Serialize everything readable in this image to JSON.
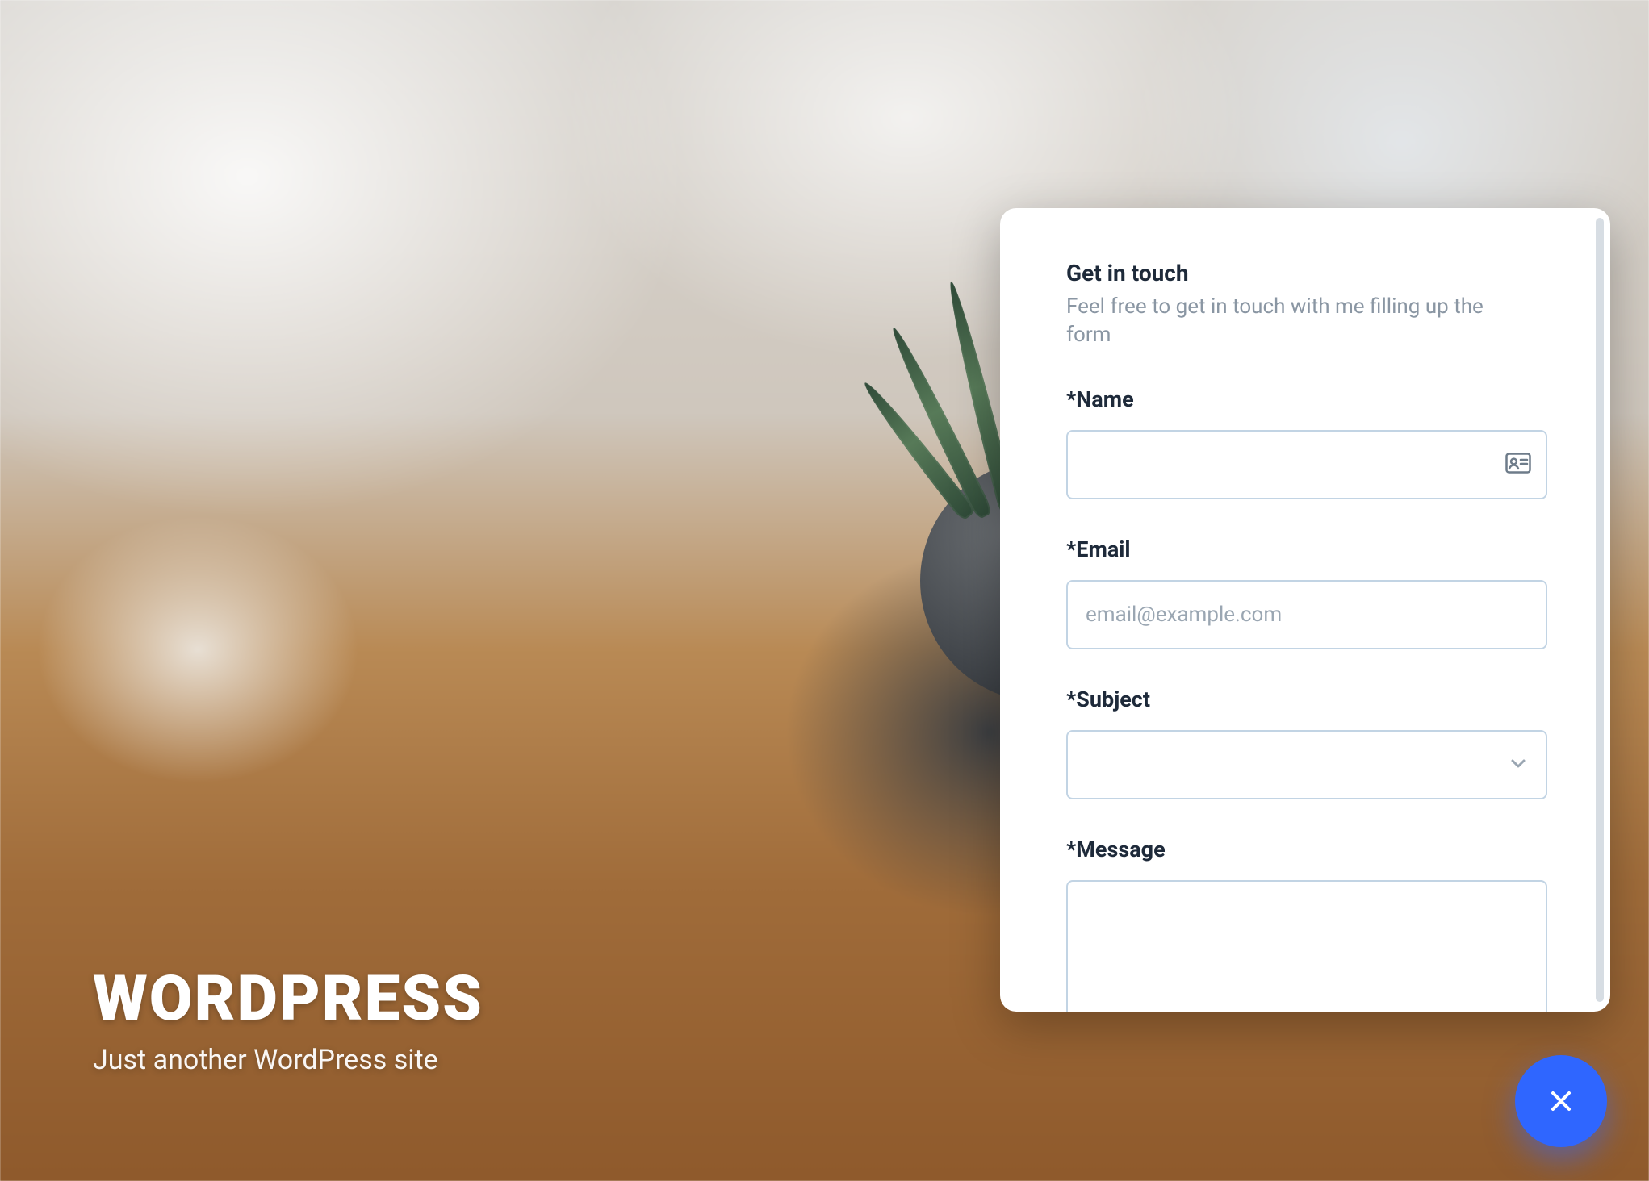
{
  "site": {
    "title": "WORDPRESS",
    "tagline": "Just another WordPress site"
  },
  "form": {
    "title": "Get in touch",
    "subtitle": "Feel free to get in touch with me filling up the form",
    "fields": {
      "name": {
        "label": "*Name",
        "value": "",
        "placeholder": ""
      },
      "email": {
        "label": "*Email",
        "value": "",
        "placeholder": "email@example.com"
      },
      "subject": {
        "label": "*Subject",
        "value": ""
      },
      "message": {
        "label": "*Message",
        "value": ""
      }
    }
  },
  "icons": {
    "contact_card": "contact-card-icon",
    "chevron_down": "chevron-down-icon",
    "close": "close-icon"
  },
  "colors": {
    "accent": "#2f66ff",
    "input_border": "#c2d4e4",
    "heading": "#1e2a3a",
    "muted": "#8a96a3"
  }
}
